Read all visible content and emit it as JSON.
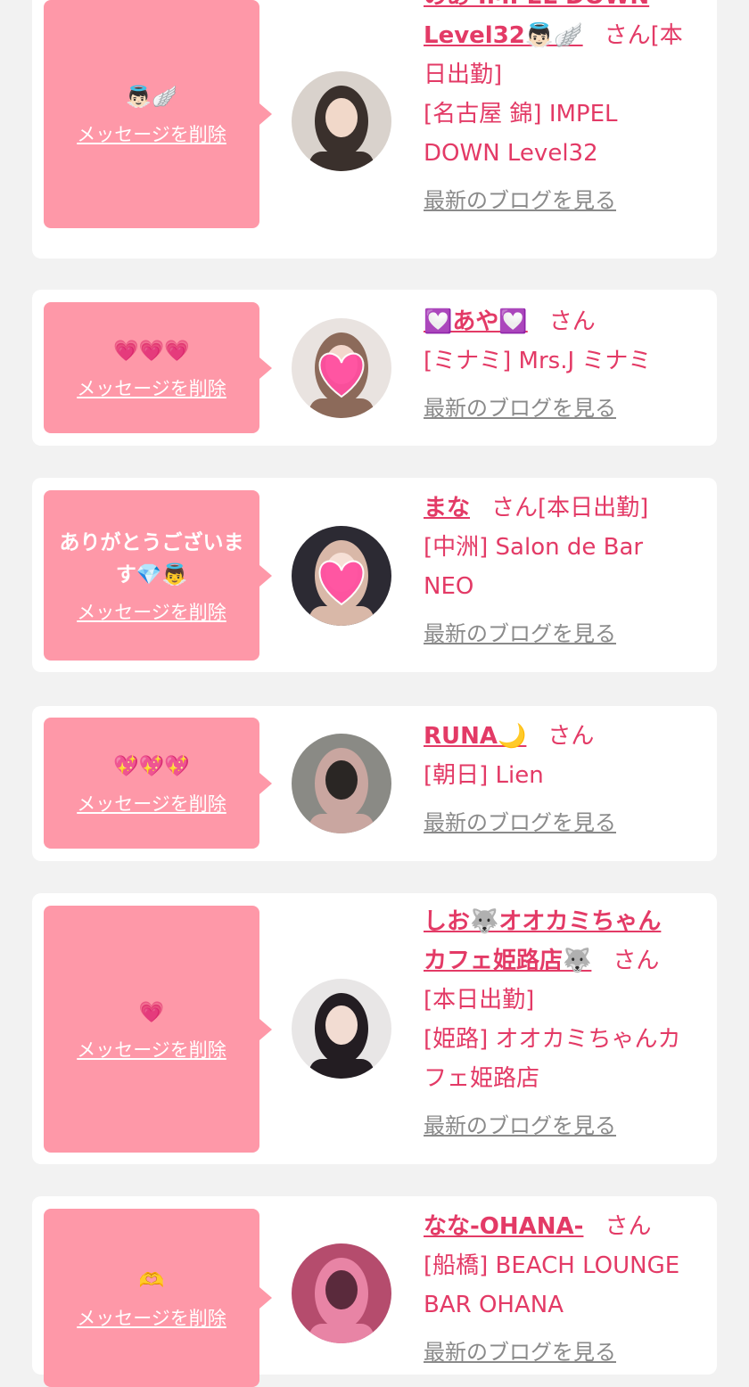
{
  "delete_label": "メッセージを削除",
  "blog_label": "最新のブログを見る",
  "san_label": "さん",
  "cards": [
    {
      "message": "👼🏻🪽",
      "name_lines": [
        "のあ IMPEL DOWN",
        "Level32👼🏻🪽"
      ],
      "after_name": "[本",
      "info_lines": [
        "日出勤]",
        "[名古屋 錦] IMPEL",
        "DOWN Level32"
      ],
      "avatar_icon": "profile-photo"
    },
    {
      "message": "💗💗💗",
      "name_lines": [
        "💟あや💟"
      ],
      "after_name": "",
      "info_lines": [
        "[ミナミ] Mrs.J ミナミ"
      ],
      "avatar_icon": "profile-photo-heart"
    },
    {
      "message": "ありがとうございます💎👼",
      "name_lines": [
        "まな"
      ],
      "after_name": "[本日出勤]",
      "info_lines": [
        "[中洲] Salon de Bar",
        "NEO"
      ],
      "avatar_icon": "profile-photo-heart"
    },
    {
      "message": "💖💖💖",
      "name_lines": [
        "RUNA🌙"
      ],
      "after_name": "",
      "info_lines": [
        "[朝日] Lien"
      ],
      "avatar_icon": "profile-photo"
    },
    {
      "message": "💗",
      "name_lines": [
        "しお🐺オオカミちゃん",
        "カフェ姫路店🐺"
      ],
      "after_name": "",
      "info_lines": [
        "[本日出勤]",
        "[姫路] オオカミちゃんカ",
        "フェ姫路店"
      ],
      "avatar_icon": "profile-photo"
    },
    {
      "message": "🫶",
      "name_lines": [
        "なな-OHANA-"
      ],
      "after_name": "",
      "info_lines": [
        "[船橋] BEACH LOUNGE",
        "BAR OHANA"
      ],
      "avatar_icon": "profile-photo"
    }
  ]
}
